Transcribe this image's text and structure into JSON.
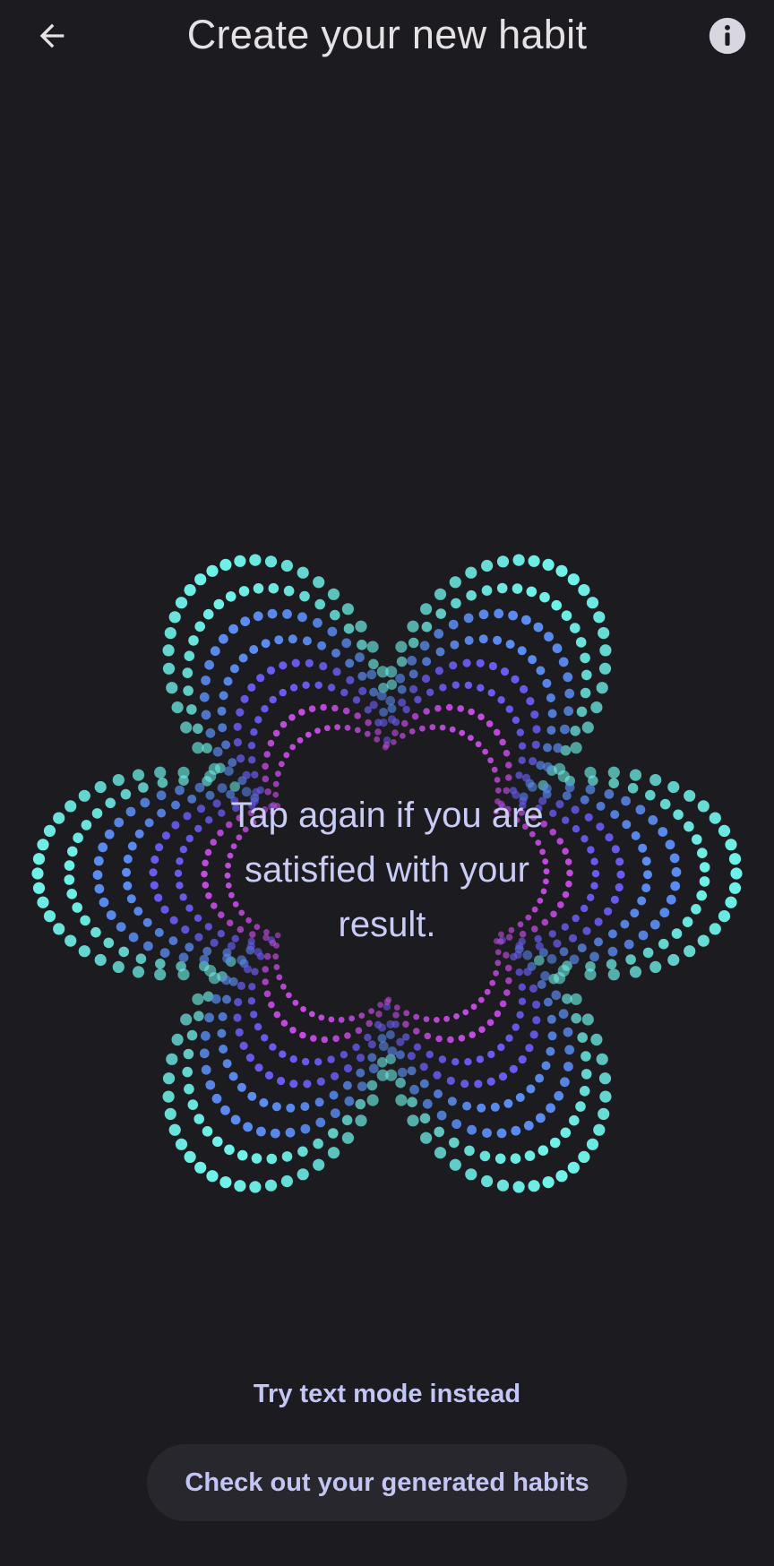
{
  "header": {
    "title": "Create your new habit",
    "back_icon": "arrow-left-icon",
    "info_icon": "info-icon"
  },
  "orb": {
    "prompt": "Tap again if you are satisfied with your result.",
    "colors": {
      "outer": "#6ff0e8",
      "middle": "#5b8cf2",
      "inner": "#6a5cf2",
      "core": "#c24be0"
    }
  },
  "actions": {
    "text_mode_label": "Try text mode instead",
    "generated_habits_label": "Check out your generated habits"
  },
  "theme": {
    "background": "#1c1b1f",
    "on_background": "#e6e1e5",
    "accent_text": "#c3c6f4",
    "button_surface": "#28272d"
  }
}
